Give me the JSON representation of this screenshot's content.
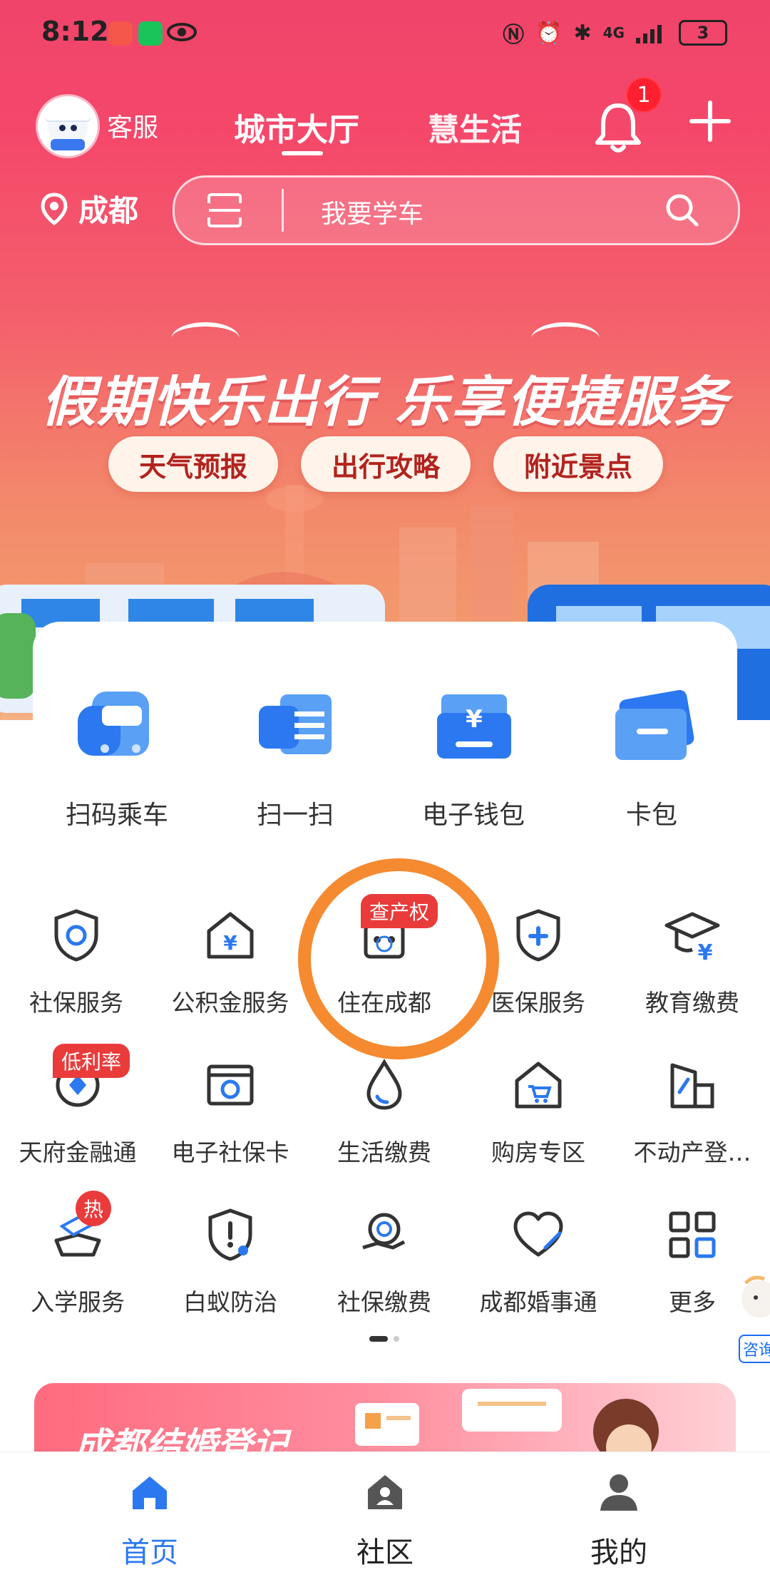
{
  "status_bar": {
    "time": "8:12",
    "network": "4G",
    "battery": "3"
  },
  "header": {
    "service_label": "客服",
    "tabs": [
      {
        "label": "城市大厅",
        "active": true
      },
      {
        "label": "慧生活",
        "active": false
      }
    ],
    "notification_count": "1"
  },
  "location": {
    "city": "成都"
  },
  "search": {
    "placeholder": "我要学车"
  },
  "banner": {
    "title": "假期快乐出行 乐享便捷服务",
    "buttons": [
      "天气预报",
      "出行攻略",
      "附近景点"
    ]
  },
  "main_actions": [
    {
      "label": "扫码乘车",
      "icon": "bus-qr-icon"
    },
    {
      "label": "扫一扫",
      "icon": "scan-icon"
    },
    {
      "label": "电子钱包",
      "icon": "wallet-icon"
    },
    {
      "label": "卡包",
      "icon": "card-icon"
    }
  ],
  "services": [
    {
      "label": "社保服务",
      "icon": "social-security-shield-icon"
    },
    {
      "label": "公积金服务",
      "icon": "housing-fund-icon"
    },
    {
      "label": "住在成都",
      "icon": "panda-house-icon",
      "tag": "查产权"
    },
    {
      "label": "医保服务",
      "icon": "medical-shield-icon"
    },
    {
      "label": "教育缴费",
      "icon": "graduation-cap-icon"
    },
    {
      "label": "天府金融通",
      "icon": "finance-diamond-icon",
      "tag": "低利率"
    },
    {
      "label": "电子社保卡",
      "icon": "social-security-card-icon"
    },
    {
      "label": "生活缴费",
      "icon": "water-drop-icon"
    },
    {
      "label": "购房专区",
      "icon": "house-cart-icon"
    },
    {
      "label": "不动产登…",
      "icon": "property-building-icon"
    },
    {
      "label": "入学服务",
      "icon": "school-enrollment-icon",
      "tag": "热"
    },
    {
      "label": "白蚁防治",
      "icon": "termite-shield-icon"
    },
    {
      "label": "社保缴费",
      "icon": "social-security-pay-icon"
    },
    {
      "label": "成都婚事通",
      "icon": "heart-icon"
    },
    {
      "label": "更多",
      "icon": "grid-more-icon"
    }
  ],
  "floating": {
    "label": "咨询"
  },
  "promo": {
    "title": "成都结婚登记"
  },
  "bottom_nav": [
    {
      "label": "首页",
      "icon": "home-icon",
      "active": true
    },
    {
      "label": "社区",
      "icon": "community-icon",
      "active": false
    },
    {
      "label": "我的",
      "icon": "profile-icon",
      "active": false
    }
  ],
  "colors": {
    "brand_red": "#f0446a",
    "accent_blue": "#2b78f0",
    "highlight_ring": "#f58a30",
    "tag_red": "#ea3b3b"
  }
}
